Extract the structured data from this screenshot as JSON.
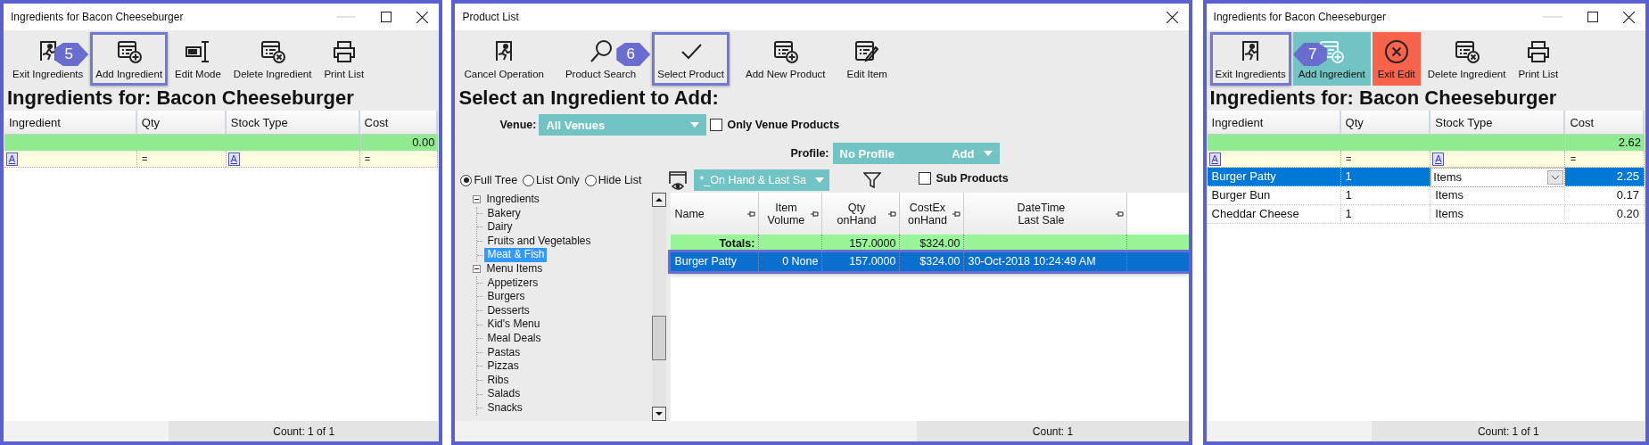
{
  "windows": [
    {
      "kind": "ingredients",
      "title": "Ingredients for Bacon Cheeseburger",
      "resizable": true,
      "toolbar": [
        {
          "label": "Exit Ingredients",
          "kind": "exit",
          "highlighted": false
        },
        {
          "label": "Add Ingredient",
          "kind": "add",
          "highlighted": true,
          "callout": "5"
        },
        {
          "label": "Edit Mode",
          "kind": "edit-mode",
          "highlighted": false
        },
        {
          "label": "Delete Ingredient",
          "kind": "delete",
          "highlighted": false
        },
        {
          "label": "Print List",
          "kind": "print",
          "highlighted": false
        }
      ],
      "heading": "Ingredients for: Bacon Cheeseburger",
      "columns": [
        {
          "label": "Ingredient",
          "filter": {
            "kind": "text",
            "symbol": "A"
          }
        },
        {
          "label": "Qty",
          "filter": {
            "kind": "number",
            "symbol": "="
          }
        },
        {
          "label": "Stock Type",
          "filter": {
            "kind": "text",
            "symbol": "A"
          }
        },
        {
          "label": "Cost",
          "filter": {
            "kind": "number",
            "symbol": "="
          }
        }
      ],
      "total": "0.00",
      "status": "Count: 1 of 1"
    },
    {
      "kind": "product_list",
      "title": "Product List",
      "resizable": false,
      "toolbar": [
        {
          "label": "Cancel Operation",
          "kind": "exit",
          "highlighted": false
        },
        {
          "label": "Product Search",
          "kind": "search",
          "highlighted": false
        },
        {
          "label": "Select Product",
          "kind": "check",
          "highlighted": true,
          "callout": "6"
        },
        {
          "label": "Add New Product",
          "kind": "add",
          "highlighted": false
        },
        {
          "label": "Edit Item",
          "kind": "edit-item",
          "highlighted": false
        }
      ],
      "heading": "Select an Ingredient to Add:",
      "venue": {
        "label": "Venue:",
        "value": "All Venues"
      },
      "only_venue": {
        "label": "Only Venue Products",
        "checked": false
      },
      "profile": {
        "label": "Profile:",
        "value": "No Profile",
        "action": "Add"
      },
      "view_modes": [
        {
          "label": "Full Tree",
          "selected": true
        },
        {
          "label": "List Only",
          "selected": false
        },
        {
          "label": "Hide List",
          "selected": false
        }
      ],
      "layout": {
        "value": "*_On Hand & Last Sa"
      },
      "sub_products": {
        "label": "Sub Products",
        "checked": false
      },
      "tree": [
        {
          "label": "Ingredients",
          "expanded": true,
          "selected": false,
          "children": [
            {
              "label": "Bakery",
              "selected": false
            },
            {
              "label": "Dairy",
              "selected": false
            },
            {
              "label": "Fruits and Vegetables",
              "selected": false
            },
            {
              "label": "Meat & Fish",
              "selected": true
            }
          ]
        },
        {
          "label": "Menu Items",
          "expanded": true,
          "selected": false,
          "children": [
            {
              "label": "Appetizers",
              "selected": false
            },
            {
              "label": "Burgers",
              "selected": false
            },
            {
              "label": "Desserts",
              "selected": false
            },
            {
              "label": "Kid's Menu",
              "selected": false
            },
            {
              "label": "Meal Deals",
              "selected": false
            },
            {
              "label": "Pastas",
              "selected": false
            },
            {
              "label": "Pizzas",
              "selected": false
            },
            {
              "label": "Ribs",
              "selected": false
            },
            {
              "label": "Salads",
              "selected": false
            },
            {
              "label": "Snacks",
              "selected": false
            }
          ]
        }
      ],
      "grid": {
        "columns": [
          {
            "lines": [
              "Name"
            ]
          },
          {
            "lines": [
              "Item",
              "Volume"
            ]
          },
          {
            "lines": [
              "Qty",
              "onHand"
            ]
          },
          {
            "lines": [
              "CostEx",
              "onHand"
            ]
          },
          {
            "lines": [
              "DateTime",
              "Last Sale"
            ]
          }
        ],
        "totals": {
          "label": "Totals:",
          "qty_on_hand": "157.0000",
          "costex_on_hand": "$324.00"
        },
        "rows": [
          {
            "cells": [
              "Burger Patty",
              "0 None",
              "157.0000",
              "$324.00",
              "30-Oct-2018 10:24:49 AM"
            ],
            "selected": true,
            "highlighted": true
          }
        ]
      },
      "status": "Count: 1"
    },
    {
      "kind": "ingredients",
      "title": "Ingredients for Bacon Cheeseburger",
      "resizable": true,
      "toolbar": [
        {
          "label": "Exit Ingredients",
          "kind": "exit",
          "highlighted": true,
          "callout": "7"
        },
        {
          "label": "Add Ingredient",
          "kind": "add",
          "highlighted": false,
          "color": "#72c4c4"
        },
        {
          "label": "Exit Edit",
          "kind": "cancel",
          "highlighted": false,
          "color": "#f8634b"
        },
        {
          "label": "Delete Ingredient",
          "kind": "delete",
          "highlighted": false
        },
        {
          "label": "Print List",
          "kind": "print",
          "highlighted": false
        }
      ],
      "heading": "Ingredients for: Bacon Cheeseburger",
      "columns": [
        {
          "label": "Ingredient",
          "filter": {
            "kind": "text",
            "symbol": "A"
          }
        },
        {
          "label": "Qty",
          "filter": {
            "kind": "number",
            "symbol": "="
          }
        },
        {
          "label": "Stock Type",
          "filter": {
            "kind": "text",
            "symbol": "A"
          }
        },
        {
          "label": "Cost",
          "filter": {
            "kind": "number",
            "symbol": "="
          }
        }
      ],
      "total": "2.62",
      "rows": [
        {
          "cells": [
            "Burger Patty",
            "1",
            "Items",
            "2.25"
          ],
          "selected": true,
          "editing": true
        },
        {
          "cells": [
            "Burger Bun",
            "1",
            "Items",
            "0.17"
          ],
          "selected": false,
          "editing": false
        },
        {
          "cells": [
            "Cheddar Cheese",
            "1",
            "Items",
            "0.20"
          ],
          "selected": false,
          "editing": false
        }
      ],
      "status": "Count: 1 of 1"
    }
  ]
}
